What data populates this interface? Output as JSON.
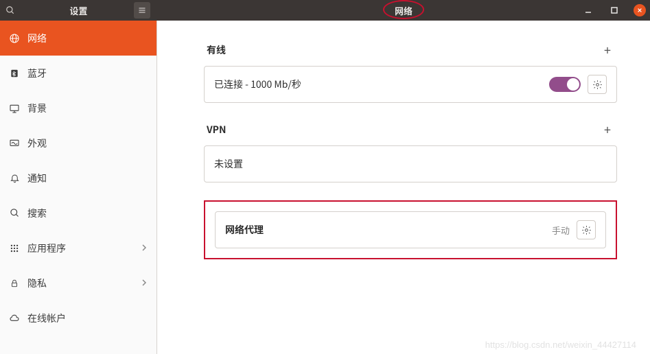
{
  "titlebar": {
    "left_title": "设置",
    "right_title": "网络"
  },
  "sidebar": {
    "items": [
      {
        "icon": "globe",
        "label": "网络",
        "active": true
      },
      {
        "icon": "bluetooth",
        "label": "蓝牙"
      },
      {
        "icon": "display",
        "label": "背景"
      },
      {
        "icon": "appearance",
        "label": "外观"
      },
      {
        "icon": "bell",
        "label": "通知"
      },
      {
        "icon": "search",
        "label": "搜索"
      },
      {
        "icon": "grid",
        "label": "应用程序",
        "chevron": true
      },
      {
        "icon": "lock",
        "label": "隐私",
        "chevron": true
      },
      {
        "icon": "cloud",
        "label": "在线帐户"
      }
    ]
  },
  "main": {
    "wired": {
      "title": "有线",
      "status": "已连接 - 1000 Mb/秒"
    },
    "vpn": {
      "title": "VPN",
      "status": "未设置"
    },
    "proxy": {
      "title": "网络代理",
      "mode": "手动"
    }
  },
  "watermark": "https://blog.csdn.net/weixin_44427114"
}
